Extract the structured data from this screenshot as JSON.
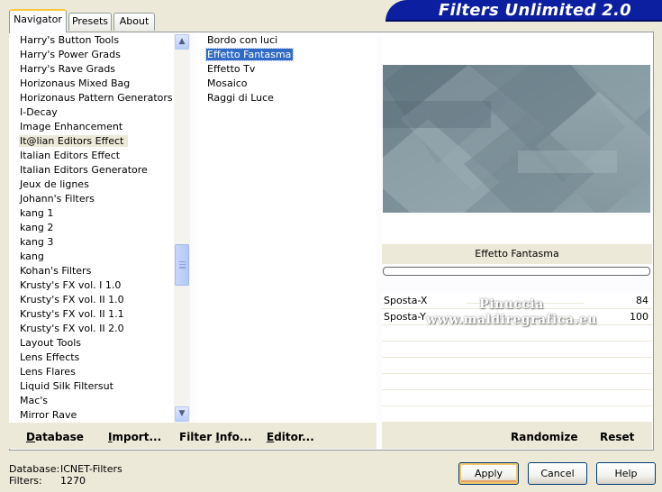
{
  "tabs": [
    {
      "label": "Navigator",
      "active": true
    },
    {
      "label": "Presets",
      "active": false
    },
    {
      "label": "About",
      "active": false
    }
  ],
  "banner": {
    "title": "Filters Unlimited 2.0",
    "color": "#0B1FA0"
  },
  "categories": {
    "items": [
      "Harry's Button Tools",
      "Harry's Power Grads",
      "Harry's Rave Grads",
      "Horizonaus Mixed Bag",
      "Horizonaus Pattern Generators",
      "I-Decay",
      "Image Enhancement",
      "It@lian Editors Effect",
      "Italian Editors Effect",
      "Italian Editors Generatore",
      "Jeux de lignes",
      "Johann's Filters",
      "kang 1",
      "kang 2",
      "kang 3",
      "kang",
      "Kohan's Filters",
      "Krusty's FX vol. I 1.0",
      "Krusty's FX vol. II 1.0",
      "Krusty's FX vol. II 1.1",
      "Krusty's FX vol. II 2.0",
      "Layout Tools",
      "Lens Effects",
      "Lens Flares",
      "Liquid Silk Filtersut",
      "Mac's",
      "Mirror Rave"
    ],
    "current_index": 7
  },
  "filters": {
    "items": [
      "Bordo con luci",
      "Effetto Fantasma",
      "Effetto Tv",
      "Mosaico",
      "Raggi di Luce"
    ],
    "selected_index": 1
  },
  "preview": {
    "filter_name": "Effetto Fantasma"
  },
  "params": [
    {
      "label": "Sposta-X",
      "value": "84"
    },
    {
      "label": "Sposta-Y",
      "value": "100"
    }
  ],
  "watermark": {
    "line1": "Pinuccia",
    "line2": "www.maldiregrafica.eu"
  },
  "toolbar": {
    "database": {
      "accel": "D",
      "rest": "atabase"
    },
    "import": {
      "accel": "I",
      "rest": "mport..."
    },
    "filter_info": {
      "pre": "Filter ",
      "accel": "I",
      "rest": "nfo..."
    },
    "editor": {
      "accel": "E",
      "rest": "ditor..."
    },
    "randomize": "Randomize",
    "reset": "Reset"
  },
  "status": {
    "database_label": "Database:",
    "database_value": "ICNET-Filters",
    "filters_label": "Filters:",
    "filters_value": "1270"
  },
  "dialog": {
    "apply": "Apply",
    "cancel": "Cancel",
    "help": "Help"
  }
}
